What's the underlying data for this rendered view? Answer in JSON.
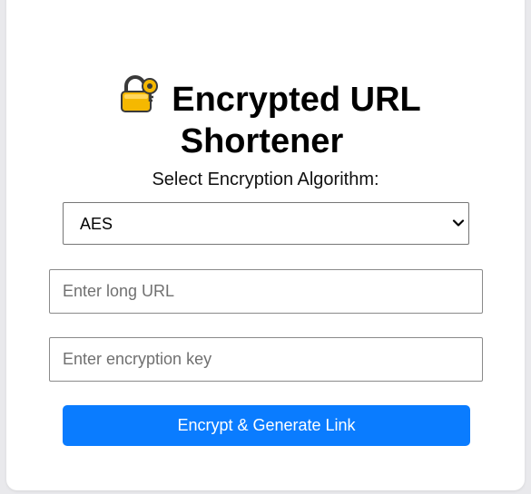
{
  "header": {
    "title_line1": "Encrypted URL",
    "title_line2": "Shortener",
    "icon": "lock-with-key-icon"
  },
  "algorithm": {
    "label": "Select Encryption Algorithm:",
    "selected": "AES"
  },
  "form": {
    "url_placeholder": "Enter long URL",
    "url_value": "",
    "key_placeholder": "Enter encryption key",
    "key_value": ""
  },
  "actions": {
    "encrypt_label": "Encrypt & Generate Link"
  },
  "colors": {
    "accent": "#0a7cff",
    "background": "#e9e9ec",
    "card": "#ffffff"
  }
}
